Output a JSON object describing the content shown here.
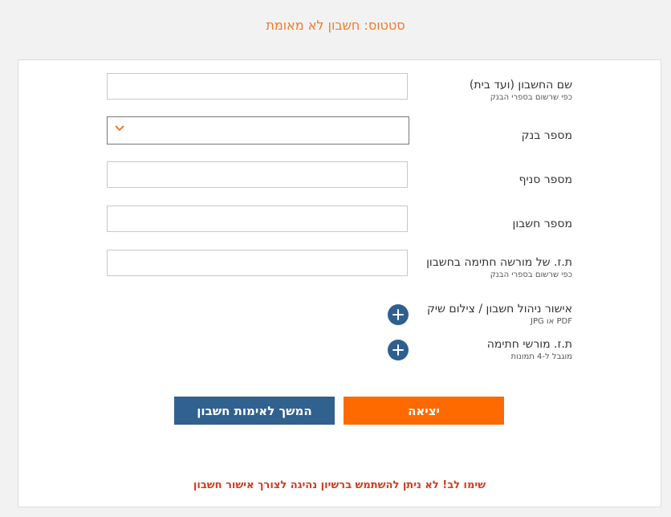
{
  "status_text": "סטטוס: חשבון לא מאומת",
  "form": {
    "account_name": {
      "label": "שם החשבון (ועד בית)",
      "sublabel": "כפי שרשום בספרי הבנק",
      "value": ""
    },
    "bank_number": {
      "label": "מספר בנק",
      "selected": ""
    },
    "branch_number": {
      "label": "מספר סניף",
      "value": ""
    },
    "account_number": {
      "label": "מספר חשבון",
      "value": ""
    },
    "signatory_id": {
      "label": "ת.ז. של מורשה חתימה בחשבון",
      "sublabel": "כפי שרשום בספרי הבנק",
      "value": ""
    },
    "account_approval": {
      "label": "אישור ניהול חשבון / צילום שיק",
      "sublabel": "PDF או JPG"
    },
    "signatories_ids": {
      "label": "ת.ז. מורשי חתימה",
      "sublabel": "מוגבל ל-4 תמונות"
    }
  },
  "buttons": {
    "exit": "יציאה",
    "continue": "המשך לאימות חשבון"
  },
  "warning": "שימו לב! לא ניתן להשתמש ברשיון נהיגה לצורך אישור חשבון",
  "colors": {
    "accent_orange": "#ff6a00",
    "primary_blue": "#31618f",
    "warning_red": "#d23c1e",
    "status_orange": "#f07a2a"
  },
  "icons": {
    "bank_select": "chevron-down-icon",
    "upload": "plus-circle-icon"
  }
}
